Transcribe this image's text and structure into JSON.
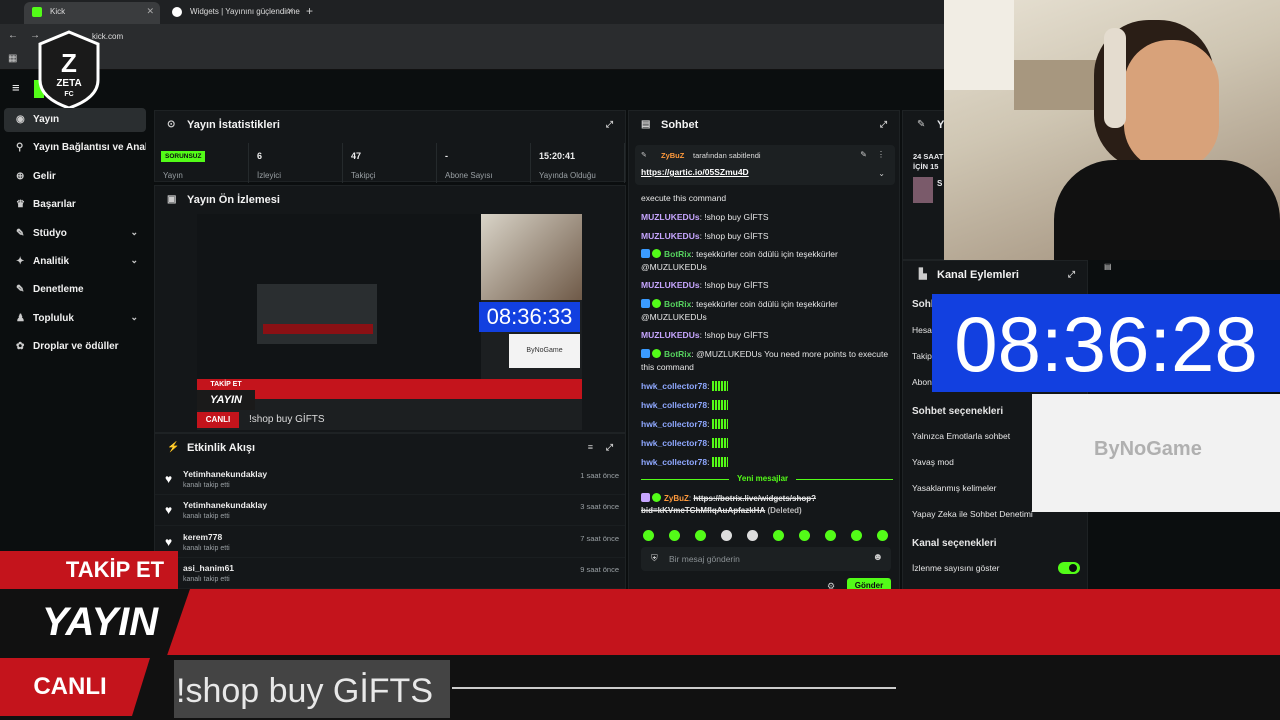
{
  "browser": {
    "tabs": [
      {
        "label": "Kick",
        "icon": "kick-favicon"
      },
      {
        "label": "Widgets | Yayınını güçlendirme",
        "icon": "widgets-favicon"
      }
    ],
    "new_tab": "+",
    "url": "kick.com"
  },
  "logo": {
    "line1": "Z",
    "line2": "ZETA",
    "line3": "FC"
  },
  "sidebar": {
    "items": [
      {
        "label": "Yayın",
        "icon": "broadcast-icon",
        "active": true
      },
      {
        "label": "Yayın Bağlantısı ve Anahtarı",
        "icon": "link-icon"
      },
      {
        "label": "Gelir",
        "icon": "coin-icon"
      },
      {
        "label": "Başarılar",
        "icon": "trophy-icon"
      },
      {
        "label": "Stüdyo",
        "icon": "brush-icon",
        "chevron": "⌄"
      },
      {
        "label": "Analitik",
        "icon": "chart-icon",
        "chevron": "⌄"
      },
      {
        "label": "Denetleme",
        "icon": "wrench-icon"
      },
      {
        "label": "Topluluk",
        "icon": "people-icon",
        "chevron": "⌄"
      },
      {
        "label": "Droplar ve ödüller",
        "icon": "gift-icon"
      }
    ]
  },
  "stats_panel": {
    "title": "Yayın İstatistikleri",
    "status_badge": "SORUNSUZ",
    "stats": [
      {
        "value": "",
        "label": "Yayın"
      },
      {
        "value": "6",
        "label": "İzleyici"
      },
      {
        "value": "47",
        "label": "Takipçi"
      },
      {
        "value": "-",
        "label": "Abone Sayısı"
      },
      {
        "value": "15:20:41",
        "label": "Yayında Olduğu"
      }
    ]
  },
  "preview_panel": {
    "title": "Yayın Ön İzlemesi",
    "clock": "08:36:33",
    "brand": "ByNoGame",
    "takip": "TAKİP ET",
    "yayin": "YAYIN",
    "canli": "CANLI",
    "ticker": "!shop buy GİFTS"
  },
  "activity_panel": {
    "title": "Etkinlik Akışı",
    "items": [
      {
        "name": "Yetimhanekundaklay",
        "sub": "kanalı takip etti",
        "time": "1 saat önce"
      },
      {
        "name": "Yetimhanekundaklay",
        "sub": "kanalı takip etti",
        "time": "3 saat önce"
      },
      {
        "name": "kerem778",
        "sub": "kanalı takip etti",
        "time": "7 saat önce"
      },
      {
        "name": "asi_hanim61",
        "sub": "kanalı takip etti",
        "time": "9 saat önce"
      }
    ]
  },
  "chat": {
    "title": "Sohbet",
    "pinned_by": "ZyBuZ",
    "pinned_suffix": "tarafından sabitlendi",
    "pinned_link": "https://gartic.io/05SZmu4D",
    "messages": [
      {
        "user": "",
        "text": "execute this command",
        "kind": "plain"
      },
      {
        "user": "MUZLUKEDUs",
        "text": ": !shop buy GİFTS",
        "kind": "user"
      },
      {
        "user": "MUZLUKEDUs",
        "text": ": !shop buy GİFTS",
        "kind": "user"
      },
      {
        "user": "BotRix",
        "text": ": teşekkürler coin ödülü için teşekkürler @MUZLUKEDUs",
        "kind": "bot"
      },
      {
        "user": "MUZLUKEDUs",
        "text": ": !shop buy GİFTS",
        "kind": "user"
      },
      {
        "user": "BotRix",
        "text": ": teşekkürler coin ödülü için teşekkürler @MUZLUKEDUs",
        "kind": "bot"
      },
      {
        "user": "MUZLUKEDUs",
        "text": ": !shop buy GİFTS",
        "kind": "user"
      },
      {
        "user": "BotRix",
        "text": ": @MUZLUKEDUs You need more points to execute this command",
        "kind": "bot"
      },
      {
        "user": "hwk_collector78",
        "text": ":",
        "kind": "emote"
      },
      {
        "user": "hwk_collector78",
        "text": ":",
        "kind": "emote"
      },
      {
        "user": "hwk_collector78",
        "text": ":",
        "kind": "emote"
      },
      {
        "user": "hwk_collector78",
        "text": ":",
        "kind": "emote"
      },
      {
        "user": "hwk_collector78",
        "text": ":",
        "kind": "emote"
      }
    ],
    "new_messages": "Yeni mesajlar",
    "deleted_user": "ZyBuZ",
    "deleted_link": "https://botrix.live/widgets/shop?bid=kKVmcTChMflqAuApfazkHA",
    "deleted_tag": "(Deleted)",
    "input_placeholder": "Bir mesaj gönderin",
    "send": "Gönder"
  },
  "right_panel": {
    "title": "Y",
    "lines": [
      "24 SAAT",
      "İÇİN 15"
    ],
    "s": "S"
  },
  "kanal": {
    "title": "Kanal Eylemleri",
    "sohbet_partial": "Sohb",
    "partial_rows": [
      "Hesa",
      "Takip",
      "Abon"
    ],
    "sohbet_heading": "Sohbet seçenekleri",
    "options": [
      "Yalnızca Emotlarla sohbet",
      "Yavaş mod",
      "Yasaklanmış kelimeler",
      "Yapay Zeka ile Sohbet Denetimi"
    ],
    "kanal_heading": "Kanal seçenekleri",
    "kanal_option": "İzlenme sayısını göster"
  },
  "overlay": {
    "clock": "08:36:28",
    "brand": "ByNoGame",
    "takip": "TAKİP ET",
    "yayin": "YAYIN",
    "canli": "CANLI",
    "ticker": "!shop buy GİFTS"
  },
  "colors": {
    "accent": "#53fc18",
    "red": "#c4141c",
    "blue": "#1240e0"
  }
}
